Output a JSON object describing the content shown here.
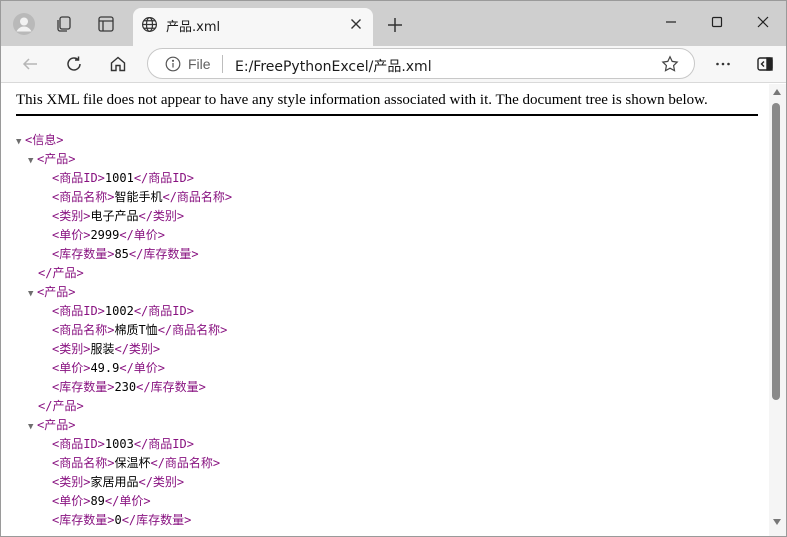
{
  "tab": {
    "title": "产品.xml"
  },
  "address": {
    "scheme": "File",
    "url": "E:/FreePythonExcel/产品.xml"
  },
  "banner": "This XML file does not appear to have any style information associated with it. The document tree is shown below.",
  "tree": [
    {
      "indent": 0,
      "toggle": true,
      "open": "<信息>"
    },
    {
      "indent": 1,
      "toggle": true,
      "open": "<产品>"
    },
    {
      "indent": 2,
      "open": "<商品ID>",
      "text": "1001",
      "close": "</商品ID>"
    },
    {
      "indent": 2,
      "open": "<商品名称>",
      "text": "智能手机",
      "close": "</商品名称>"
    },
    {
      "indent": 2,
      "open": "<类别>",
      "text": "电子产品",
      "close": "</类别>"
    },
    {
      "indent": 2,
      "open": "<单价>",
      "text": "2999",
      "close": "</单价>"
    },
    {
      "indent": 2,
      "open": "<库存数量>",
      "text": "85",
      "close": "</库存数量>"
    },
    {
      "indent": 1,
      "close": "</产品>"
    },
    {
      "indent": 1,
      "toggle": true,
      "open": "<产品>"
    },
    {
      "indent": 2,
      "open": "<商品ID>",
      "text": "1002",
      "close": "</商品ID>"
    },
    {
      "indent": 2,
      "open": "<商品名称>",
      "text": "棉质T恤",
      "close": "</商品名称>"
    },
    {
      "indent": 2,
      "open": "<类别>",
      "text": "服装",
      "close": "</类别>"
    },
    {
      "indent": 2,
      "open": "<单价>",
      "text": "49.9",
      "close": "</单价>"
    },
    {
      "indent": 2,
      "open": "<库存数量>",
      "text": "230",
      "close": "</库存数量>"
    },
    {
      "indent": 1,
      "close": "</产品>"
    },
    {
      "indent": 1,
      "toggle": true,
      "open": "<产品>"
    },
    {
      "indent": 2,
      "open": "<商品ID>",
      "text": "1003",
      "close": "</商品ID>"
    },
    {
      "indent": 2,
      "open": "<商品名称>",
      "text": "保温杯",
      "close": "</商品名称>"
    },
    {
      "indent": 2,
      "open": "<类别>",
      "text": "家居用品",
      "close": "</类别>"
    },
    {
      "indent": 2,
      "open": "<单价>",
      "text": "89",
      "close": "</单价>"
    },
    {
      "indent": 2,
      "open": "<库存数量>",
      "text": "0",
      "close": "</库存数量>"
    }
  ],
  "icons": {
    "profile": "profile-avatar-icon",
    "workspaces": "workspaces-icon",
    "tab_actions": "tab-actions-icon",
    "globe": "globe-icon",
    "close": "close-icon",
    "new_tab": "plus-icon",
    "back": "back-arrow-icon",
    "refresh": "refresh-icon",
    "home": "home-icon",
    "info": "info-icon",
    "favorite": "star-icon",
    "more": "more-icon",
    "sidebar": "sidebar-icon"
  }
}
